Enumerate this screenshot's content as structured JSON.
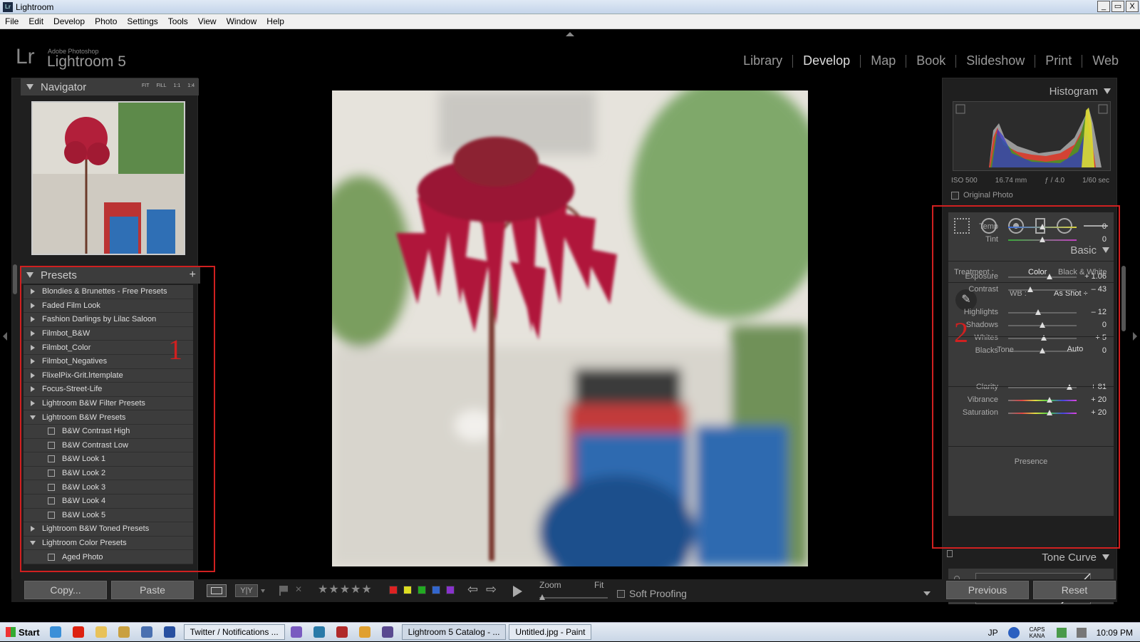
{
  "window": {
    "title": "Lightroom",
    "icon_label": "Lr",
    "min": "_",
    "max": "▭",
    "close": "X"
  },
  "menu": [
    "File",
    "Edit",
    "Develop",
    "Photo",
    "Settings",
    "Tools",
    "View",
    "Window",
    "Help"
  ],
  "identity": {
    "mark": "Lr",
    "vendor": "Adobe Photoshop",
    "product": "Lightroom 5"
  },
  "modules": [
    {
      "label": "Library",
      "active": false
    },
    {
      "label": "Develop",
      "active": true
    },
    {
      "label": "Map",
      "active": false
    },
    {
      "label": "Book",
      "active": false
    },
    {
      "label": "Slideshow",
      "active": false
    },
    {
      "label": "Print",
      "active": false
    },
    {
      "label": "Web",
      "active": false
    }
  ],
  "navigator": {
    "title": "Navigator",
    "zoom": [
      "FIT",
      "FILL",
      "1:1",
      "1:4"
    ]
  },
  "presets": {
    "title": "Presets",
    "add": "+",
    "items": [
      {
        "label": "Blondies & Brunettes - Free Presets",
        "kind": "folder",
        "open": false
      },
      {
        "label": "Faded Film Look",
        "kind": "folder",
        "open": false
      },
      {
        "label": "Fashion Darlings by Lilac Saloon",
        "kind": "folder",
        "open": false
      },
      {
        "label": "Filmbot_B&W",
        "kind": "folder",
        "open": false
      },
      {
        "label": "Filmbot_Color",
        "kind": "folder",
        "open": false
      },
      {
        "label": "Filmbot_Negatives",
        "kind": "folder",
        "open": false
      },
      {
        "label": "FlixelPix-Grit.lrtemplate",
        "kind": "folder",
        "open": false
      },
      {
        "label": "Focus-Street-Life",
        "kind": "folder",
        "open": false
      },
      {
        "label": "Lightroom B&W Filter Presets",
        "kind": "folder",
        "open": false
      },
      {
        "label": "Lightroom B&W Presets",
        "kind": "folder",
        "open": true
      },
      {
        "label": "B&W Contrast High",
        "kind": "preset"
      },
      {
        "label": "B&W Contrast Low",
        "kind": "preset"
      },
      {
        "label": "B&W Look 1",
        "kind": "preset"
      },
      {
        "label": "B&W Look 2",
        "kind": "preset"
      },
      {
        "label": "B&W Look 3",
        "kind": "preset"
      },
      {
        "label": "B&W Look 4",
        "kind": "preset"
      },
      {
        "label": "B&W Look 5",
        "kind": "preset"
      },
      {
        "label": "Lightroom B&W Toned Presets",
        "kind": "folder",
        "open": false
      },
      {
        "label": "Lightroom Color Presets",
        "kind": "folder",
        "open": true
      },
      {
        "label": "Aged Photo",
        "kind": "preset"
      }
    ]
  },
  "annotations": {
    "one": "1",
    "two": "2",
    "color": "#d02020"
  },
  "histogram": {
    "title": "Histogram",
    "iso": "ISO 500",
    "focal": "16.74 mm",
    "aperture": "ƒ / 4.0",
    "shutter": "1/60 sec",
    "original_photo": "Original Photo"
  },
  "basic": {
    "title": "Basic",
    "treatment_label": "Treatment :",
    "treatment_color": "Color",
    "treatment_bw": "Black & White",
    "wb_label": "WB :",
    "wb_value": "As Shot ÷",
    "tone_label": "Tone",
    "auto": "Auto",
    "presence_label": "Presence",
    "sliders": {
      "temp": {
        "label": "Temp",
        "value": "0",
        "pos": 0.5
      },
      "tint": {
        "label": "Tint",
        "value": "0",
        "pos": 0.5
      },
      "exposure": {
        "label": "Exposure",
        "value": "+ 1.06",
        "pos": 0.6
      },
      "contrast": {
        "label": "Contrast",
        "value": "– 43",
        "pos": 0.32
      },
      "highlights": {
        "label": "Highlights",
        "value": "– 12",
        "pos": 0.44
      },
      "shadows": {
        "label": "Shadows",
        "value": "0",
        "pos": 0.5
      },
      "whites": {
        "label": "Whites",
        "value": "+ 5",
        "pos": 0.52
      },
      "blacks": {
        "label": "Blacks",
        "value": "0",
        "pos": 0.5
      },
      "clarity": {
        "label": "Clarity",
        "value": "+ 81",
        "pos": 0.9
      },
      "vibrance": {
        "label": "Vibrance",
        "value": "+ 20",
        "pos": 0.6
      },
      "saturation": {
        "label": "Saturation",
        "value": "+ 20",
        "pos": 0.6
      }
    }
  },
  "tone_curve": {
    "title": "Tone Curve"
  },
  "right_buttons": {
    "previous": "Previous",
    "reset": "Reset"
  },
  "left_buttons": {
    "copy": "Copy...",
    "paste": "Paste"
  },
  "toolbar": {
    "view_yy": "Y|Y",
    "stars": [
      "★",
      "★",
      "★",
      "★",
      "★"
    ],
    "colors": [
      "#d22",
      "#dd2",
      "#2a2",
      "#36c",
      "#83c"
    ],
    "zoom_label": "Zoom",
    "zoom_fit": "Fit",
    "soft_proofing": "Soft Proofing"
  },
  "taskbar": {
    "start": "Start",
    "tasks": [
      {
        "label": "Twitter / Notifications ...",
        "active": false
      },
      {
        "label": "Lightroom 5 Catalog - ...",
        "active": true
      },
      {
        "label": "Untitled.jpg - Paint",
        "active": false
      }
    ],
    "lang": "JP",
    "caps": "CAPS KANA",
    "clock": "10:09 PM"
  }
}
